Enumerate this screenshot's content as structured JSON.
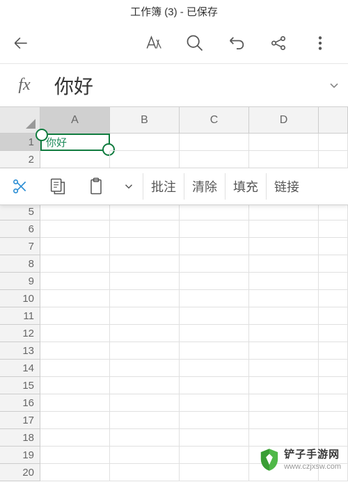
{
  "title": "工作簿 (3) - 已保存",
  "formula": {
    "fx_label": "fx",
    "value": "你好"
  },
  "columns": [
    "A",
    "B",
    "C",
    "D"
  ],
  "active_col": "A",
  "row_count": 20,
  "active_row": 1,
  "cells": {
    "A1": "你好"
  },
  "context": {
    "annotate": "批注",
    "clear": "清除",
    "fill": "填充",
    "link": "链接"
  },
  "watermark": {
    "brand": "铲子手游网",
    "url": "www.czjxsw.com"
  }
}
